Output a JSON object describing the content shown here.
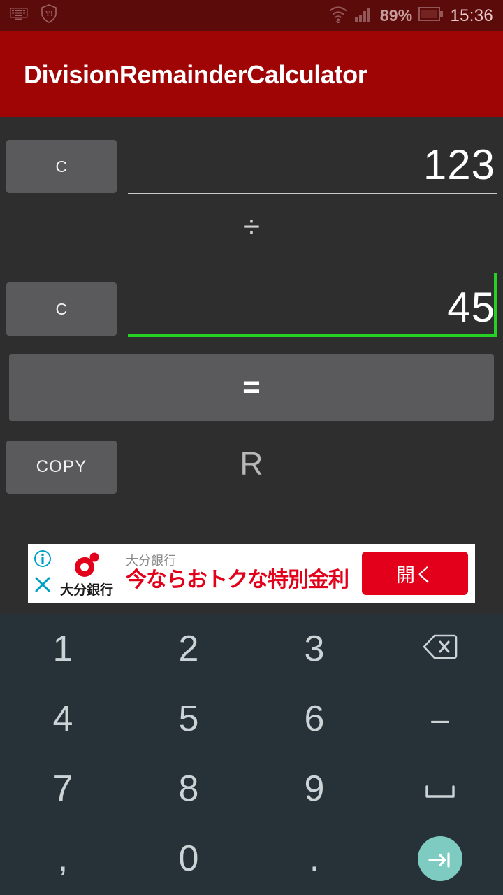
{
  "status_bar": {
    "icons": [
      "keyboard-icon",
      "shield-icon",
      "wifi-icon",
      "signal-icon"
    ],
    "battery_percent": "89%",
    "clock": "15:36",
    "background_color": "#5c0b0b"
  },
  "app_bar": {
    "title": "DivisionRemainderCalculator",
    "background_color": "#a00505"
  },
  "calculator": {
    "dividend": {
      "clear_label": "C",
      "value": "123",
      "focused": false
    },
    "operator": "÷",
    "divisor": {
      "clear_label": "C",
      "value": "45",
      "focused": true,
      "accent_color": "#25d124"
    },
    "equals_label": "=",
    "copy_label": "COPY",
    "remainder_label": "R",
    "background_color": "#2e2e2e"
  },
  "ad": {
    "advertiser": "大分銀行",
    "subtitle": "大分銀行",
    "headline": "今ならおトクな特別金利",
    "cta_label": "開く",
    "cta_color": "#e2001a",
    "info_icon": "info-icon",
    "close_icon": "close-icon",
    "badge_color": "#00a0c6"
  },
  "keyboard": {
    "background_color": "#273238",
    "accent_color": "#7ecbc2",
    "rows": [
      [
        {
          "label": "1",
          "name": "key-1",
          "type": "digit"
        },
        {
          "label": "2",
          "name": "key-2",
          "type": "digit"
        },
        {
          "label": "3",
          "name": "key-3",
          "type": "digit"
        },
        {
          "label": "",
          "name": "backspace-icon",
          "type": "backspace"
        }
      ],
      [
        {
          "label": "4",
          "name": "key-4",
          "type": "digit"
        },
        {
          "label": "5",
          "name": "key-5",
          "type": "digit"
        },
        {
          "label": "6",
          "name": "key-6",
          "type": "digit"
        },
        {
          "label": "–",
          "name": "key-minus",
          "type": "symbol"
        }
      ],
      [
        {
          "label": "7",
          "name": "key-7",
          "type": "digit"
        },
        {
          "label": "8",
          "name": "key-8",
          "type": "digit"
        },
        {
          "label": "9",
          "name": "key-9",
          "type": "digit"
        },
        {
          "label": "⌴",
          "name": "space-icon",
          "type": "space"
        }
      ],
      [
        {
          "label": ",",
          "name": "key-comma",
          "type": "symbol"
        },
        {
          "label": "0",
          "name": "key-0",
          "type": "digit"
        },
        {
          "label": ".",
          "name": "key-period",
          "type": "symbol"
        },
        {
          "label": "",
          "name": "next-field-icon",
          "type": "enter"
        }
      ]
    ]
  }
}
